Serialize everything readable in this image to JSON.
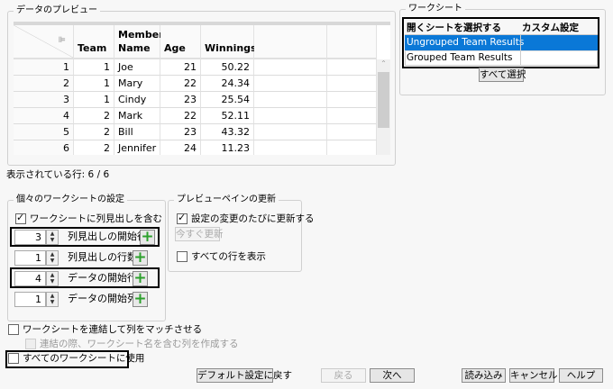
{
  "preview": {
    "title": "データのプレビュー",
    "columns": [
      {
        "line1": "",
        "line2": "Team"
      },
      {
        "line1": "Member",
        "line2": "Name"
      },
      {
        "line1": "",
        "line2": "Age"
      },
      {
        "line1": "",
        "line2": "Winnings"
      }
    ],
    "rows": [
      [
        "1",
        "1",
        "Joe",
        "21",
        "50.22"
      ],
      [
        "2",
        "1",
        "Mary",
        "22",
        "24.34"
      ],
      [
        "3",
        "1",
        "Cindy",
        "23",
        "25.54"
      ],
      [
        "4",
        "2",
        "Mark",
        "22",
        "52.11"
      ],
      [
        "5",
        "2",
        "Bill",
        "23",
        "43.32"
      ],
      [
        "6",
        "2",
        "Jennifer",
        "24",
        "11.23"
      ]
    ],
    "rows_shown": "表示されている行: 6 / 6"
  },
  "worksheet": {
    "title": "ワークシート",
    "col_open": "開くシートを選択する",
    "col_custom": "カスタム設定",
    "sheets": [
      "Ungrouped Team Results",
      "Grouped Team Results"
    ],
    "select_all": "すべて選択",
    "selected_color": "#0a78d7"
  },
  "individual": {
    "title": "個々のワークシートの設定",
    "include_headers": "ワークシートに列見出しを含む",
    "spinners": [
      {
        "value": "3",
        "label": "列見出しの開始行"
      },
      {
        "value": "1",
        "label": "列見出しの行数"
      },
      {
        "value": "4",
        "label": "データの開始行"
      },
      {
        "value": "1",
        "label": "データの開始列"
      }
    ]
  },
  "preview_update": {
    "title": "プレビューペインの更新",
    "update_on_change": "設定の変更のたびに更新する",
    "update_now": "今すぐ更新",
    "show_all_rows": "すべての行を表示"
  },
  "options": {
    "concat": "ワークシートを連結して列をマッチさせる",
    "concat_name": "連結の際、ワークシート名を含む列を作成する",
    "use_all": "すべてのワークシートに使用"
  },
  "buttons": {
    "defaults": "デフォルト設定に戻す",
    "back": "戻る",
    "next": "次へ",
    "import": "読み込み",
    "cancel": "キャンセル",
    "help": "ヘルプ"
  }
}
